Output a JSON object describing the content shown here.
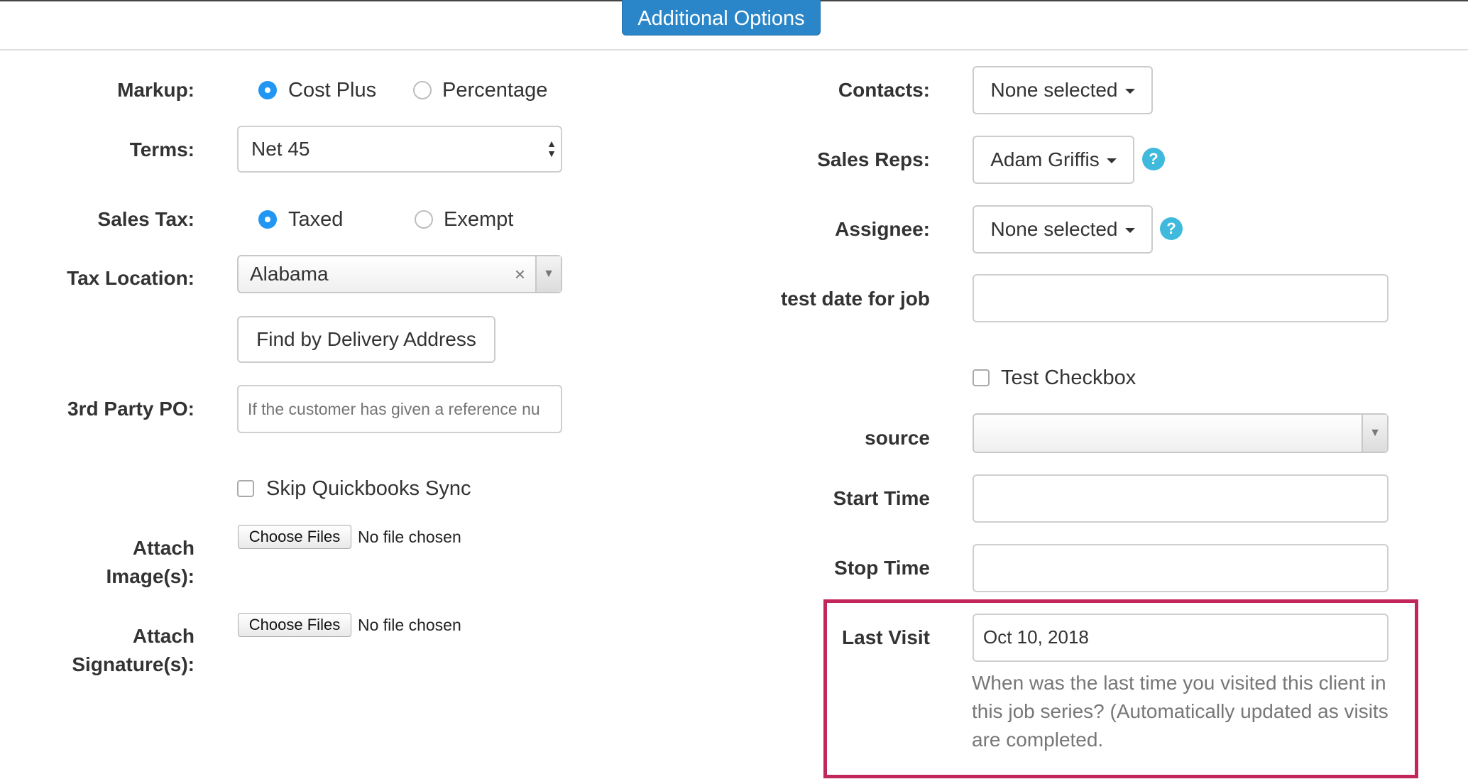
{
  "header": {
    "tab_label": "Additional Options"
  },
  "left": {
    "markup": {
      "label": "Markup:",
      "options": [
        "Cost Plus",
        "Percentage"
      ],
      "selected": "Cost Plus"
    },
    "terms": {
      "label": "Terms:",
      "value": "Net 45"
    },
    "sales_tax": {
      "label": "Sales Tax:",
      "options": [
        "Taxed",
        "Exempt"
      ],
      "selected": "Taxed"
    },
    "tax_location": {
      "label": "Tax Location:",
      "value": "Alabama",
      "clear_glyph": "×",
      "arrow_glyph": "▼"
    },
    "find_button": "Find by Delivery Address",
    "third_party_po": {
      "label": "3rd Party PO:",
      "placeholder": "If the customer has given a reference nu"
    },
    "skip_qb": {
      "label": "Skip Quickbooks Sync",
      "checked": false
    },
    "attach_images": {
      "label_line1": "Attach",
      "label_line2": "Image(s):",
      "button": "Choose Files",
      "status": "No file chosen"
    },
    "attach_signatures": {
      "label_line1": "Attach",
      "label_line2": "Signature(s):",
      "button": "Choose Files",
      "status": "No file chosen"
    }
  },
  "right": {
    "contacts": {
      "label": "Contacts:",
      "value": "None selected"
    },
    "sales_reps": {
      "label": "Sales Reps:",
      "value": "Adam Griffis",
      "help": "?"
    },
    "assignee": {
      "label": "Assignee:",
      "value": "None selected",
      "help": "?"
    },
    "test_date": {
      "label": "test date for job",
      "value": ""
    },
    "test_checkbox": {
      "label": "Test Checkbox",
      "checked": false
    },
    "source": {
      "label": "source",
      "value": "",
      "arrow_glyph": "▼"
    },
    "start_time": {
      "label": "Start Time",
      "value": ""
    },
    "stop_time": {
      "label": "Stop Time",
      "value": ""
    },
    "last_visit": {
      "label": "Last Visit",
      "value": "Oct 10, 2018",
      "help_line1": "When was the last time you visited this client in",
      "help_line2": "this job series? (Automatically updated as visits",
      "help_line3": "are completed."
    }
  },
  "colors": {
    "accent": "#2a86c8",
    "radio_selected": "#2196f3",
    "help_icon": "#3fb9dc",
    "highlight_border": "#c2275c"
  }
}
